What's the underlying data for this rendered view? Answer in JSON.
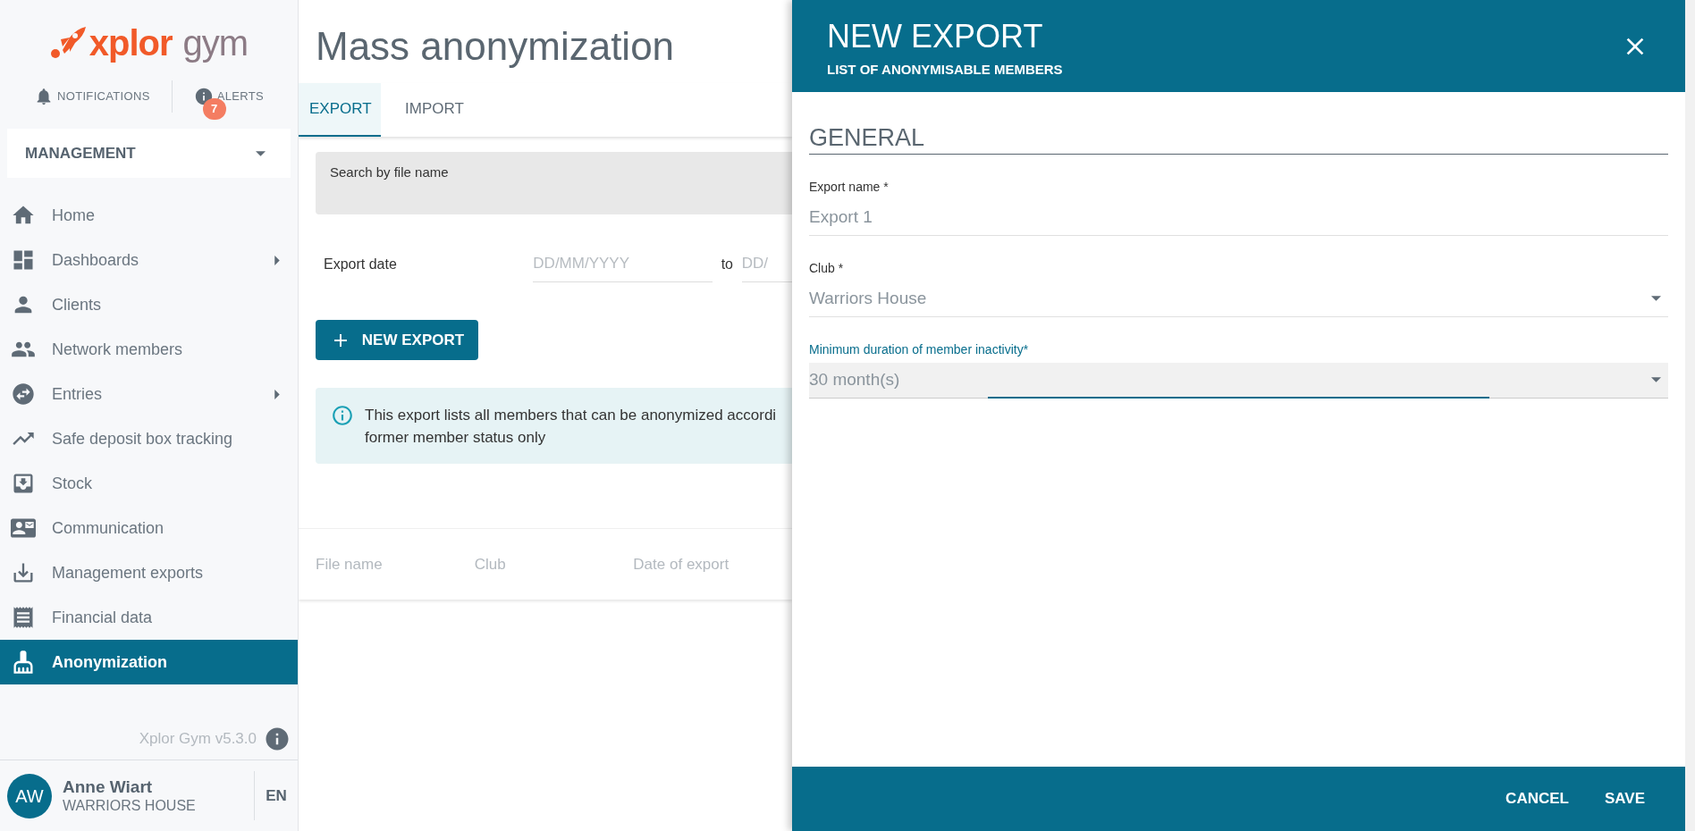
{
  "logo": {
    "word_1": "xplor",
    "word_2": "gym"
  },
  "header_links": [
    {
      "label": "NOTIFICATIONS"
    },
    {
      "label": "ALERTS",
      "badge": "7"
    }
  ],
  "module_select": {
    "value": "MANAGEMENT"
  },
  "nav": [
    {
      "label": "Home",
      "selected": false,
      "has_submenu": false
    },
    {
      "label": "Dashboards",
      "selected": false,
      "has_submenu": true
    },
    {
      "label": "Clients",
      "selected": false,
      "has_submenu": false
    },
    {
      "label": "Network members",
      "selected": false,
      "has_submenu": false
    },
    {
      "label": "Entries",
      "selected": false,
      "has_submenu": true
    },
    {
      "label": "Safe deposit box tracking",
      "selected": false,
      "has_submenu": false
    },
    {
      "label": "Stock",
      "selected": false,
      "has_submenu": false
    },
    {
      "label": "Communication",
      "selected": false,
      "has_submenu": false
    },
    {
      "label": "Management exports",
      "selected": false,
      "has_submenu": false
    },
    {
      "label": "Financial data",
      "selected": false,
      "has_submenu": false
    },
    {
      "label": "Anonymization",
      "selected": true,
      "has_submenu": false
    }
  ],
  "version": "Xplor Gym v5.3.0",
  "user": {
    "initials": "AW",
    "name": "Anne Wiart",
    "club": "WARRIORS HOUSE",
    "language": "EN"
  },
  "page": {
    "title": "Mass anonymization",
    "tabs": [
      {
        "label": "EXPORT",
        "selected": true
      },
      {
        "label": "IMPORT",
        "selected": false
      }
    ],
    "search": {
      "label": "Search by file name"
    },
    "date_filter": {
      "label": "Export date",
      "from_placeholder": "DD/MM/YYYY",
      "separator": "to",
      "to_placeholder": "DD/"
    },
    "new_button": "NEW EXPORT",
    "info_lines": [
      "This export lists all members that can be anonymized accordi",
      "former member status only"
    ],
    "table": {
      "columns": [
        "File name",
        "Club",
        "Date of export"
      ]
    }
  },
  "panel": {
    "title": "NEW EXPORT",
    "subtitle": "LIST OF ANONYMISABLE MEMBERS",
    "section": "GENERAL",
    "fields": [
      {
        "kind": "text",
        "label": "Export name *",
        "value": "Export 1",
        "focused": false
      },
      {
        "kind": "select",
        "label": "Club *",
        "value": "Warriors House",
        "focused": false
      },
      {
        "kind": "select",
        "label": "Minimum duration of member inactivity*",
        "value": "30 month(s)",
        "focused": true
      }
    ],
    "actions": [
      "CANCEL",
      "SAVE"
    ]
  }
}
